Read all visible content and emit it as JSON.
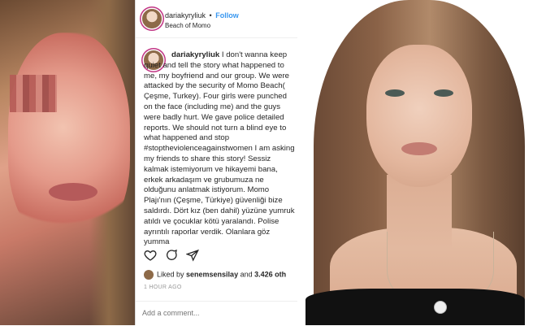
{
  "post": {
    "header": {
      "username": "dariakyryliuk",
      "separator": "•",
      "follow_label": "Follow",
      "location": "Beach of Momo"
    },
    "caption": {
      "username": "dariakyryliuk",
      "text": "I don't wanna keep quiet and tell the story what happened to me, my boyfriend and our group. We were attacked by the security of Momo Beach( Çeşme, Turkey). Four girls were punched on the face (including me) and the guys were badly hurt. We gave police detailed reports. We should not turn a blind eye to what happened and stop #stoptheviolenceagainstwomen I am asking my friends to share this story! Sessiz kalmak istemiyorum ve hikayemi bana, erkek arkadaşım ve grubumuza ne olduğunu anlatmak istiyorum. Momo Plajı'nın (Çeşme, Türkiye) güvenliği bize saldırdı. Dört kız (ben dahil) yüzüne yumruk atıldı ve çocuklar kötü yaralandı. Polise ayrıntılı raporlar verdik. Olanlara göz yumma"
    },
    "actions": {
      "like_icon": "heart-icon",
      "comment_icon": "comment-icon",
      "share_icon": "share-icon"
    },
    "likes": {
      "prefix": "Liked by ",
      "user": "senemsensilay",
      "middle": " and ",
      "count": "3.426 oth"
    },
    "time": "1 HOUR AGO",
    "comment_placeholder": "Add a comment..."
  }
}
